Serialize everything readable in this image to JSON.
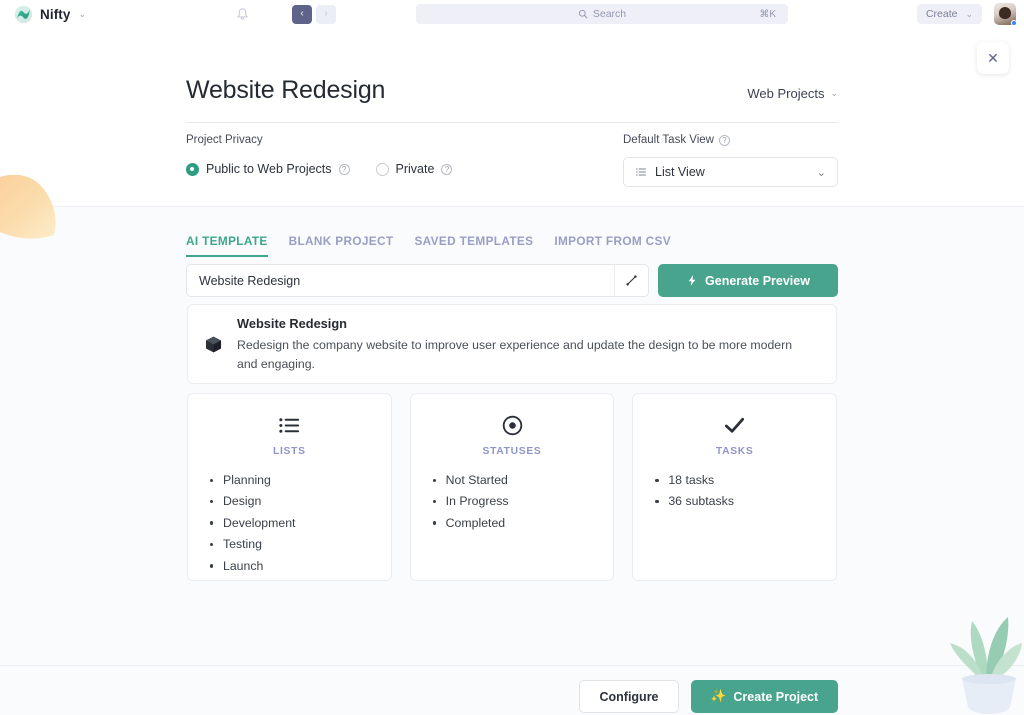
{
  "topbar": {
    "brand_name": "Nifty",
    "brand_caret": "⌄",
    "bell_icon": "bell-icon",
    "nav_back": "‹",
    "nav_forward": "›",
    "search_placeholder": "Search",
    "search_shortcut": "⌘K",
    "create_label": "Create",
    "create_caret": "⌄"
  },
  "close_label": "✕",
  "header": {
    "project_title": "Website Redesign",
    "scope_label": "Web Projects",
    "scope_caret": "⌄"
  },
  "settings": {
    "privacy_label": "Project Privacy",
    "privacy_options": [
      {
        "label": "Public to Web Projects",
        "selected": true
      },
      {
        "label": "Private",
        "selected": false
      }
    ],
    "task_view_label": "Default Task View",
    "task_view_value": "List View",
    "task_view_caret": "⌄",
    "help_glyph": "?"
  },
  "tabs": [
    {
      "label": "AI TEMPLATE",
      "selected": true
    },
    {
      "label": "BLANK PROJECT",
      "selected": false
    },
    {
      "label": "SAVED TEMPLATES",
      "selected": false
    },
    {
      "label": "IMPORT FROM CSV",
      "selected": false
    }
  ],
  "prompt": {
    "value": "Website Redesign",
    "expand_icon": "expand-diagonal-icon",
    "generate_label": "Generate Preview"
  },
  "description_card": {
    "icon": "cube-icon",
    "title": "Website Redesign",
    "body": "Redesign the company website to improve user experience and update the design to be more modern and engaging."
  },
  "preview_cards": [
    {
      "icon": "list-icon",
      "label": "LISTS",
      "items": [
        "Planning",
        "Design",
        "Development",
        "Testing",
        "Launch"
      ]
    },
    {
      "icon": "target-dot-icon",
      "label": "STATUSES",
      "items": [
        "Not Started",
        "In Progress",
        "Completed"
      ]
    },
    {
      "icon": "check-icon",
      "label": "TASKS",
      "items": [
        "18 tasks",
        "36 subtasks"
      ]
    }
  ],
  "footer": {
    "configure_label": "Configure",
    "create_project_label": "Create Project",
    "create_project_icon": "✨"
  },
  "colors": {
    "accent_teal": "#49a48d",
    "radio_selected": "#2f9e80",
    "tab_active": "#3fa58c",
    "tab_inactive": "#9a9ec4",
    "card_label_purple": "#9095c9",
    "nav_active": "#5f6289",
    "page_bg": "#fafbfc",
    "status_dot": "#4285f4"
  }
}
